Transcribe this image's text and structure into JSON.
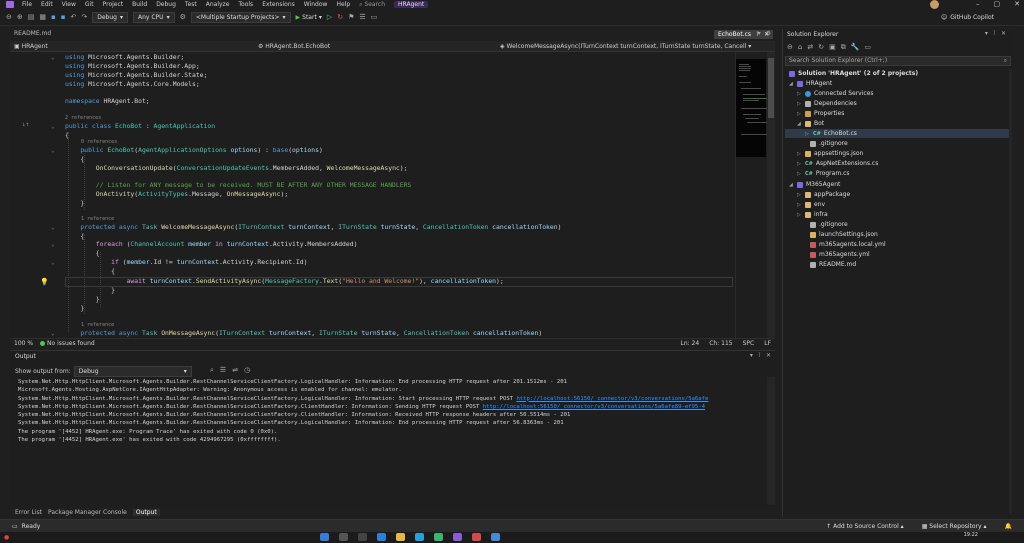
{
  "menu": {
    "items": [
      "File",
      "Edit",
      "View",
      "Git",
      "Project",
      "Build",
      "Debug",
      "Test",
      "Analyze",
      "Tools",
      "Extensions",
      "Window",
      "Help"
    ],
    "search": "Search",
    "project": "HRAgent"
  },
  "toolbar": {
    "config": "Debug",
    "platform": "Any CPU",
    "startup": "<Multiple Startup Projects>",
    "start": "Start",
    "copilot": "GitHub Copilot"
  },
  "doc_tabs": {
    "readme": "README.md",
    "active": "EchoBot.cs"
  },
  "navbar": {
    "project": "HRAgent",
    "class": "HRAgent.Bot.EchoBot",
    "member": "WelcomeMessageAsync(ITurnContext turnContext, ITurnState turnState, Cancell"
  },
  "editor": {
    "using1": "Microsoft.Agents.Builder;",
    "using2": "Microsoft.Agents.Builder.App;",
    "using3": "Microsoft.Agents.Builder.State;",
    "using4": "Microsoft.Agents.Core.Models;",
    "namespace": "HRAgent.Bot;",
    "refs_class": "2 references",
    "class_name": "EchoBot",
    "base_class": "AgentApplication",
    "refs_ctor": "0 references",
    "refs_1": "1 reference",
    "comment": "// Listen for ANY message to be received. MUST BE AFTER ANY OTHER MESSAGE HANDLERS",
    "hello": "\"Hello and Welcome!\""
  },
  "editor_status": {
    "zoom": "100 %",
    "issues": "No issues found",
    "ln": "Ln: 24",
    "ch": "Ch: 115",
    "spc": "SPC",
    "lf": "LF"
  },
  "output": {
    "title": "Output",
    "show_from_label": "Show output from:",
    "show_from_value": "Debug",
    "lines": [
      "System.Net.Http.HttpClient.Microsoft.Agents.Builder.RestChannelServiceClientFactory.LogicalHandler: Information: End processing HTTP request after 201.1512ms - 201",
      "Microsoft.Agents.Hosting.AspNetCore.IAgentHttpAdapter: Warning: Anonymous access is enabled for channel: emulator.",
      "System.Net.Http.HttpClient.Microsoft.Agents.Builder.RestChannelServiceClientFactory.LogicalHandler: Information: Start processing HTTP request POST ",
      "System.Net.Http.HttpClient.Microsoft.Agents.Builder.RestChannelServiceClientFactory.ClientHandler: Information: Sending HTTP request POST ",
      "System.Net.Http.HttpClient.Microsoft.Agents.Builder.RestChannelServiceClientFactory.ClientHandler: Information: Received HTTP response headers after 50.5514ms - 201",
      "System.Net.Http.HttpClient.Microsoft.Agents.Builder.RestChannelServiceClientFactory.LogicalHandler: Information: End processing HTTP request after 56.8363ms - 201",
      "The program '[4452] HRAgent.exe: Program Trace' has exited with code 0 (0x0).",
      "The program '[4452] HRAgent.exe' has exited with code 4294967295 (0xffffffff)."
    ],
    "link1": "http://localhost:56150/_connector/v3/conversations/5a6afe",
    "link2": "http://localhost:56150/_connector/v3/conversations/5a6afe89-ef95-4"
  },
  "bottom_tabs": [
    "Error List",
    "Package Manager Console",
    "Output"
  ],
  "solution_explorer": {
    "title": "Solution Explorer",
    "search_placeholder": "Search Solution Explorer (Ctrl+;)",
    "solution": "Solution 'HRAgent' (2 of 2 projects)",
    "items": [
      {
        "label": "HRAgent",
        "icon": "project-icon"
      },
      {
        "label": "Connected Services",
        "icon": "globe-icon"
      },
      {
        "label": "Dependencies",
        "icon": "dependencies-icon"
      },
      {
        "label": "Properties",
        "icon": "properties-icon"
      },
      {
        "label": "Bot",
        "icon": "folder-icon"
      },
      {
        "label": "EchoBot.cs",
        "icon": "csharp-icon"
      },
      {
        "label": ".gitignore",
        "icon": "file-icon"
      },
      {
        "label": "appsettings.json",
        "icon": "json-icon"
      },
      {
        "label": "AspNetExtensions.cs",
        "icon": "csharp-icon"
      },
      {
        "label": "Program.cs",
        "icon": "csharp-icon"
      },
      {
        "label": "M365Agent",
        "icon": "project-icon"
      },
      {
        "label": "appPackage",
        "icon": "folder-icon"
      },
      {
        "label": "env",
        "icon": "folder-icon"
      },
      {
        "label": "infra",
        "icon": "folder-icon"
      },
      {
        "label": ".gitignore",
        "icon": "file-icon"
      },
      {
        "label": "launchSettings.json",
        "icon": "json-icon"
      },
      {
        "label": "m365agents.local.yml",
        "icon": "yml-icon"
      },
      {
        "label": "m365agents.yml",
        "icon": "yml-icon"
      },
      {
        "label": "README.md",
        "icon": "file-icon"
      }
    ]
  },
  "statusbar": {
    "ready": "Ready",
    "add_source": "Add to Source Control",
    "select_repo": "Select Repository"
  },
  "taskbar": {
    "clock": "19:22"
  }
}
